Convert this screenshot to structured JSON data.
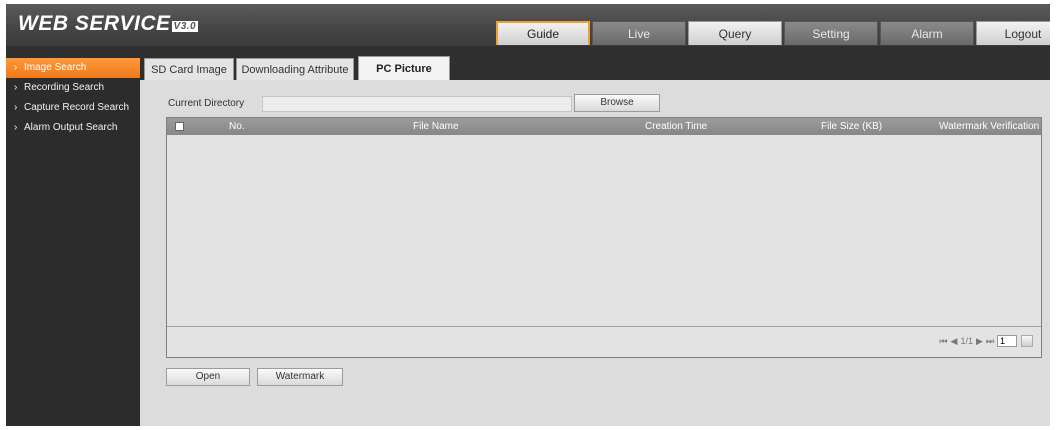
{
  "app": {
    "title": "WEB SERVICE",
    "version": "V3.0"
  },
  "topnav": [
    {
      "label": "Guide",
      "state": "active"
    },
    {
      "label": "Live",
      "state": "dark"
    },
    {
      "label": "Query",
      "state": "light"
    },
    {
      "label": "Setting",
      "state": "dark"
    },
    {
      "label": "Alarm",
      "state": "dark"
    },
    {
      "label": "Logout",
      "state": "light"
    }
  ],
  "tabs": [
    {
      "label": "SD Card Image",
      "active": false
    },
    {
      "label": "Downloading Attribute",
      "active": false
    },
    {
      "label": "PC Picture",
      "active": true
    }
  ],
  "sidebar": {
    "items": [
      {
        "label": "Image Search",
        "active": true
      },
      {
        "label": "Recording Search",
        "active": false
      },
      {
        "label": "Capture Record Search",
        "active": false
      },
      {
        "label": "Alarm Output Search",
        "active": false
      }
    ]
  },
  "directory": {
    "label": "Current Directory",
    "value": "",
    "browse_label": "Browse"
  },
  "table": {
    "columns": [
      "No.",
      "File Name",
      "Creation Time",
      "File Size (KB)",
      "Watermark Verification"
    ],
    "rows": [],
    "pager": {
      "text": "1/1",
      "page": "1"
    }
  },
  "actions": {
    "open_label": "Open",
    "watermark_label": "Watermark"
  },
  "colors": {
    "accent": "#f07818",
    "header": "#454545",
    "sidebar": "#2c2c2c"
  }
}
